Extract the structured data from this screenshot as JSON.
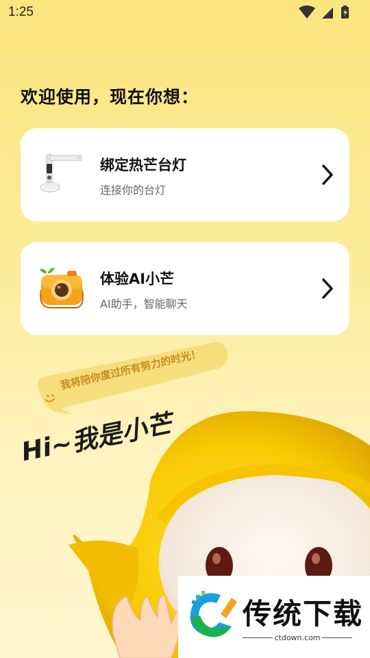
{
  "status_bar": {
    "time": "1:25",
    "icons": [
      "wifi-icon",
      "signal-icon",
      "battery-icon"
    ]
  },
  "greeting": "欢迎使用，现在你想：",
  "cards": [
    {
      "title": "绑定热芒台灯",
      "subtitle": "连接你的台灯",
      "icon": "desk-lamp-icon"
    },
    {
      "title": "体验AI小芒",
      "subtitle": "AI助手，智能聊天",
      "icon": "camera-mascot-icon"
    }
  ],
  "speech_bubble": "我将陪你度过所有努力的时光！",
  "hi_text": "Hi~我是小芒",
  "watermark": {
    "brand": "传统下载",
    "url": "ctdown.com"
  },
  "colors": {
    "background": "#fbe57f",
    "accent": "#f5c400",
    "card": "#ffffff"
  }
}
